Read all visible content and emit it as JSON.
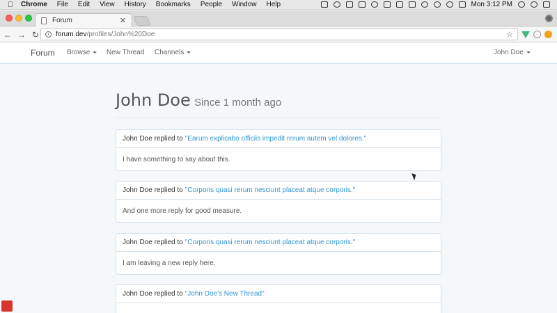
{
  "mac_menubar": {
    "app_name": "Chrome",
    "menus": [
      "File",
      "Edit",
      "View",
      "History",
      "Bookmarks",
      "People",
      "Window",
      "Help"
    ],
    "clock": "Mon 3:12 PM"
  },
  "browser": {
    "tab_title": "Forum",
    "url_host": "forum.dev",
    "url_path": "/profiles/John%20Doe"
  },
  "navbar": {
    "brand": "Forum",
    "browse": "Browse",
    "new_thread": "New Thread",
    "channels": "Channels",
    "user": "John Doe"
  },
  "profile": {
    "name": "John Doe",
    "since": "Since 1 month ago"
  },
  "activities": [
    {
      "actor": "John Doe",
      "verb": "replied to",
      "thread": "\"Earum explicabo officiis impedit rerum autem vel dolores.\"",
      "body": "I have something to say about this."
    },
    {
      "actor": "John Doe",
      "verb": "replied to",
      "thread": "\"Corporis quasi rerum nesciunt placeat atque corporis.\"",
      "body": "And one more reply for good measure."
    },
    {
      "actor": "John Doe",
      "verb": "replied to",
      "thread": "\"Corporis quasi rerum nesciunt placeat atque corporis.\"",
      "body": "I am leaving a new reply here."
    },
    {
      "actor": "John Doe",
      "verb": "replied to",
      "thread": "\"John Doe's New Thread\"",
      "body": ""
    }
  ]
}
